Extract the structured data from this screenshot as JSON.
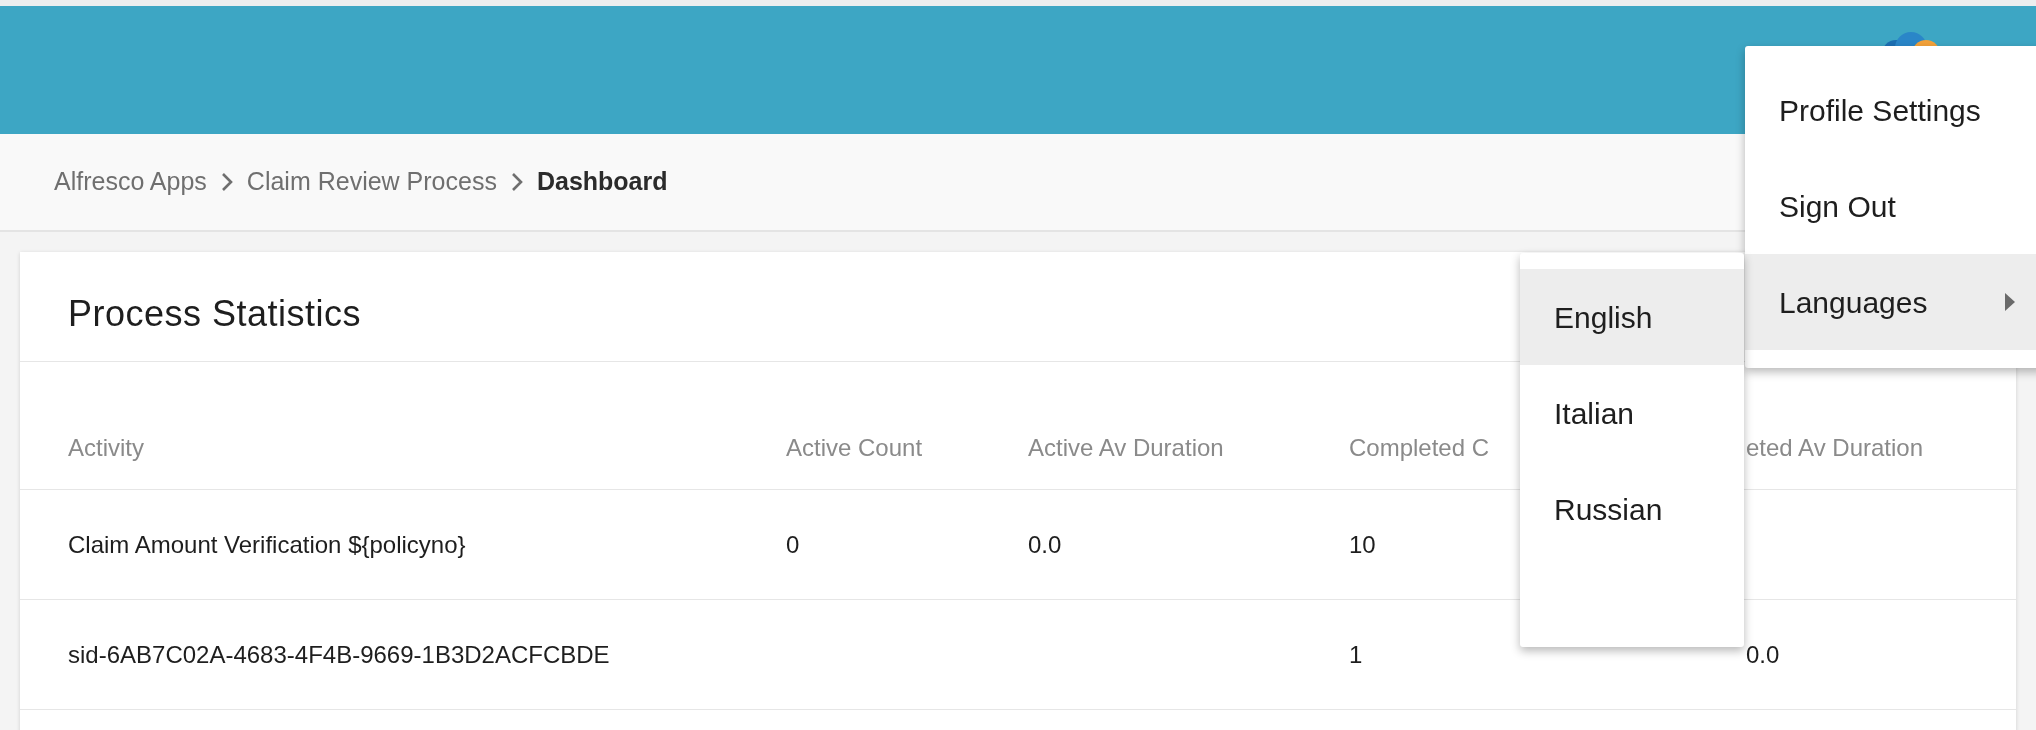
{
  "breadcrumb": [
    {
      "label": "Alfresco Apps",
      "current": false
    },
    {
      "label": "Claim Review Process",
      "current": false
    },
    {
      "label": "Dashboard",
      "current": true
    }
  ],
  "card": {
    "title": "Process Statistics",
    "table": {
      "columns": [
        "Activity",
        "Active Count",
        "Active Av Duration",
        "Completed C",
        "eted Av Duration"
      ],
      "rows": [
        {
          "activity": "Claim Amount Verification ${policyno}",
          "active_count": "0",
          "active_av_duration": "0.0",
          "completed_count": "10"
        },
        {
          "activity": "sid-6AB7C02A-4683-4F4B-9669-1B3D2ACFCBDE",
          "completed_count": "1",
          "completed_av_duration": "0.0"
        }
      ]
    }
  },
  "user_menu": {
    "items": [
      {
        "label": "Profile Settings",
        "highlighted": false,
        "has_submenu": false
      },
      {
        "label": "Sign Out",
        "highlighted": false,
        "has_submenu": false
      },
      {
        "label": "Languages",
        "highlighted": true,
        "has_submenu": true
      }
    ]
  },
  "language_menu": {
    "items": [
      {
        "label": "English",
        "highlighted": true
      },
      {
        "label": "Italian",
        "highlighted": false
      },
      {
        "label": "Russian",
        "highlighted": false
      }
    ]
  }
}
